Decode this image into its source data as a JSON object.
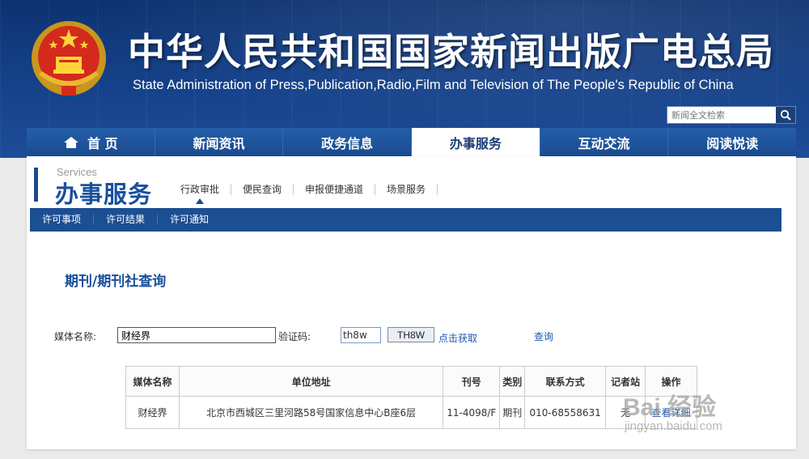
{
  "header": {
    "title_cn": "中华人民共和国国家新闻出版广电总局",
    "title_en": "State Administration of Press,Publication,Radio,Film and Television of The People's Republic of China",
    "search_placeholder": "新闻全文检索"
  },
  "main_nav": [
    {
      "label": "首 页",
      "icon": "home-icon",
      "active": false
    },
    {
      "label": "新闻资讯",
      "active": false
    },
    {
      "label": "政务信息",
      "active": false
    },
    {
      "label": "办事服务",
      "active": true
    },
    {
      "label": "互动交流",
      "active": false
    },
    {
      "label": "阅读悦读",
      "active": false
    }
  ],
  "section": {
    "title_en": "Services",
    "title_cn": "办事服务",
    "subtabs": [
      "行政审批",
      "便民查询",
      "申报便捷通道",
      "场景服务"
    ],
    "subnav": [
      "许可事项",
      "许可结果",
      "许可通知"
    ]
  },
  "query": {
    "page_title": "期刊/期刊社查询",
    "media_label": "媒体名称:",
    "media_value": "财经界",
    "code_label": "验证码:",
    "code_value": "th8w",
    "captcha_text": "TH8W",
    "refresh_link": "点击获取",
    "query_link": "查询"
  },
  "table": {
    "headers": [
      "媒体名称",
      "单位地址",
      "刊号",
      "类别",
      "联系方式",
      "记者站",
      "操作"
    ],
    "rows": [
      [
        "财经界",
        "北京市西城区三里河路58号国家信息中心B座6层",
        "11-4098/F",
        "期刊",
        "010-68558631",
        "无",
        "查看详细"
      ]
    ]
  },
  "watermark": {
    "main": "Bai 经验",
    "sub": "jingyan.baidu.com"
  },
  "colors": {
    "primary": "#1a4b8f",
    "accent": "#1a4f9c",
    "link": "#1d56b0"
  }
}
